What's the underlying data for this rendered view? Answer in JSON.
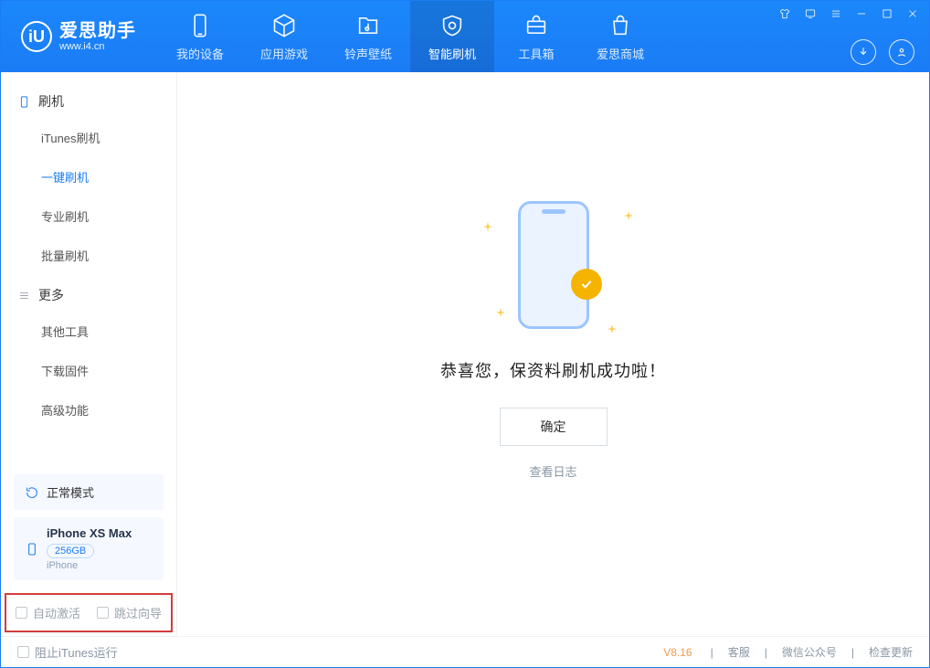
{
  "app": {
    "title": "爱思助手",
    "subtitle": "www.i4.cn"
  },
  "nav": {
    "items": [
      {
        "label": "我的设备"
      },
      {
        "label": "应用游戏"
      },
      {
        "label": "铃声壁纸"
      },
      {
        "label": "智能刷机"
      },
      {
        "label": "工具箱"
      },
      {
        "label": "爱思商城"
      }
    ]
  },
  "sidebar": {
    "group1": {
      "title": "刷机",
      "items": [
        "iTunes刷机",
        "一键刷机",
        "专业刷机",
        "批量刷机"
      ]
    },
    "group2": {
      "title": "更多",
      "items": [
        "其他工具",
        "下载固件",
        "高级功能"
      ]
    }
  },
  "device": {
    "mode": "正常模式",
    "name": "iPhone XS Max",
    "storage": "256GB",
    "type": "iPhone"
  },
  "options": {
    "auto_activate": "自动激活",
    "skip_wizard": "跳过向导"
  },
  "main": {
    "success_msg": "恭喜您，保资料刷机成功啦！",
    "ok_label": "确定",
    "view_log": "查看日志"
  },
  "status": {
    "block_itunes": "阻止iTunes运行",
    "version": "V8.16",
    "links": [
      "客服",
      "微信公众号",
      "检查更新"
    ]
  }
}
